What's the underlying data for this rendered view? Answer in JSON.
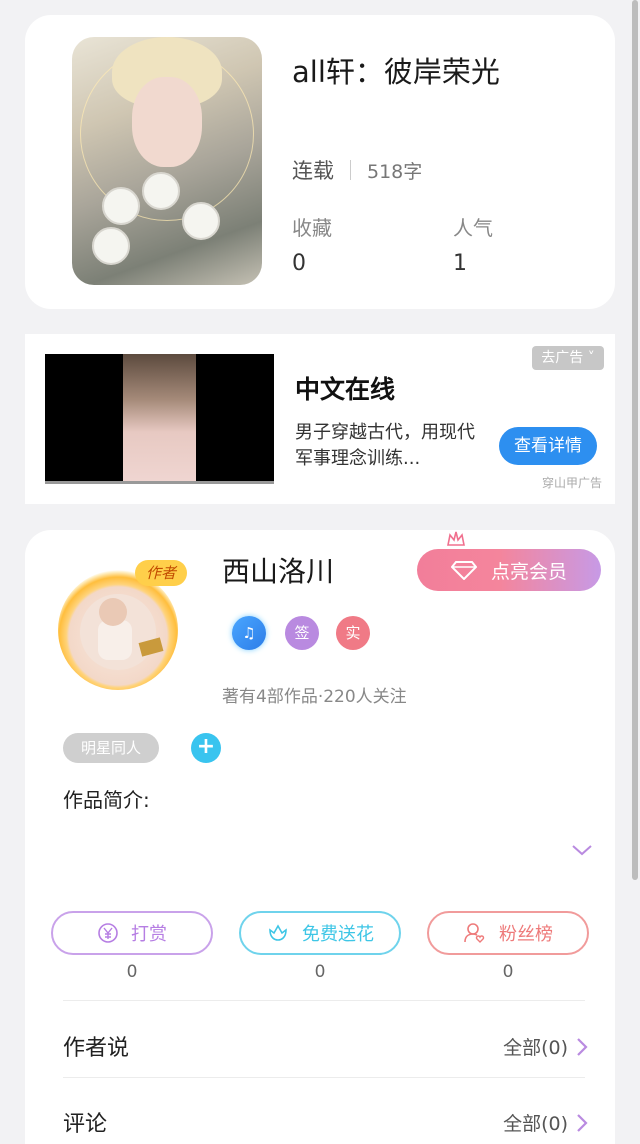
{
  "book": {
    "title": "all轩：彼岸荣光",
    "status": "连载",
    "word_count": "518字",
    "favorites_label": "收藏",
    "favorites_value": "0",
    "popularity_label": "人气",
    "popularity_value": "1"
  },
  "ad": {
    "title": "中文在线",
    "description": "男子穿越古代，用现代军事理念训练...",
    "button_label": "查看详情",
    "close_label": "去广告 ˅",
    "source_label": "穿山甲广告"
  },
  "author": {
    "avatar_tag": "作者",
    "name": "西山洛川",
    "vip_button_label": "点亮会员",
    "badge_sign": "签",
    "badge_real": "实",
    "works_line": "著有4部作品·220人关注",
    "tag": "明星同人",
    "tag_add": "+",
    "intro_label": "作品简介:"
  },
  "actions": [
    {
      "label": "打赏",
      "count": "0",
      "color": "#b67ee3"
    },
    {
      "label": "免费送花",
      "count": "0",
      "color": "#3ec6e6"
    },
    {
      "label": "粉丝榜",
      "count": "0",
      "color": "#ee7a7a"
    }
  ],
  "sections": {
    "author_says_label": "作者说",
    "author_says_right": "全部(0)",
    "comments_label": "评论",
    "comments_right": "全部(0)"
  },
  "colors": {
    "accent_purple": "#b67ee3",
    "accent_cyan": "#3ec6e6",
    "accent_red": "#ee7a7a",
    "ad_button": "#2d8ff0"
  },
  "icons": [
    "crown-icon",
    "diamond-icon",
    "music-badge-icon",
    "yen-icon",
    "flower-icon",
    "fans-icon",
    "chevron-down-icon",
    "chevron-right-icon"
  ]
}
